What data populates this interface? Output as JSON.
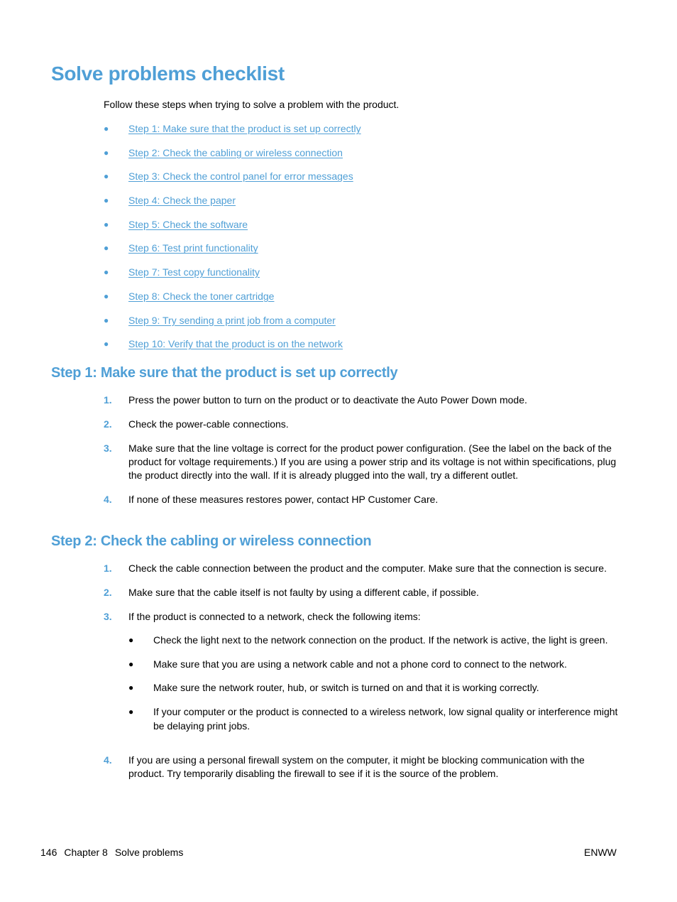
{
  "title": "Solve problems checklist",
  "intro": "Follow these steps when trying to solve a problem with the product.",
  "colors": {
    "accent": "#4f9fd6",
    "text": "#000000"
  },
  "toc": [
    {
      "label": "Step 1: Make sure that the product is set up correctly"
    },
    {
      "label": "Step 2: Check the cabling or wireless connection"
    },
    {
      "label": "Step 3: Check the control panel for error messages"
    },
    {
      "label": "Step 4: Check the paper"
    },
    {
      "label": "Step 5: Check the software"
    },
    {
      "label": "Step 6: Test print functionality"
    },
    {
      "label": "Step 7: Test copy functionality"
    },
    {
      "label": "Step 8: Check the toner cartridge"
    },
    {
      "label": "Step 9: Try sending a print job from a computer"
    },
    {
      "label": "Step 10: Verify that the product is on the network"
    }
  ],
  "bullet_glyph": "●",
  "sections": [
    {
      "heading": "Step 1: Make sure that the product is set up correctly",
      "steps": [
        {
          "num": "1.",
          "text": "Press the power button to turn on the product or to deactivate the Auto Power Down mode."
        },
        {
          "num": "2.",
          "text": "Check the power-cable connections."
        },
        {
          "num": "3.",
          "text": "Make sure that the line voltage is correct for the product power configuration. (See the label on the back of the product for voltage requirements.) If you are using a power strip and its voltage is not within specifications, plug the product directly into the wall. If it is already plugged into the wall, try a different outlet."
        },
        {
          "num": "4.",
          "text": "If none of these measures restores power, contact HP Customer Care."
        }
      ]
    },
    {
      "heading": "Step 2: Check the cabling or wireless connection",
      "steps": [
        {
          "num": "1.",
          "text": "Check the cable connection between the product and the computer. Make sure that the connection is secure."
        },
        {
          "num": "2.",
          "text": "Make sure that the cable itself is not faulty by using a different cable, if possible."
        },
        {
          "num": "3.",
          "text": "If the product is connected to a network, check the following items:",
          "sub": [
            "Check the light next to the network connection on the product. If the network is active, the light is green.",
            "Make sure that you are using a network cable and not a phone cord to connect to the network.",
            "Make sure the network router, hub, or switch is turned on and that it is working correctly.",
            "If your computer or the product is connected to a wireless network, low signal quality or interference might be delaying print jobs."
          ]
        },
        {
          "num": "4.",
          "text": "If you are using a personal firewall system on the computer, it might be blocking communication with the product. Try temporarily disabling the firewall to see if it is the source of the problem."
        }
      ]
    }
  ],
  "footer": {
    "page_number": "146",
    "chapter": "Chapter 8",
    "chapter_title": "Solve problems",
    "locale": "ENWW"
  }
}
